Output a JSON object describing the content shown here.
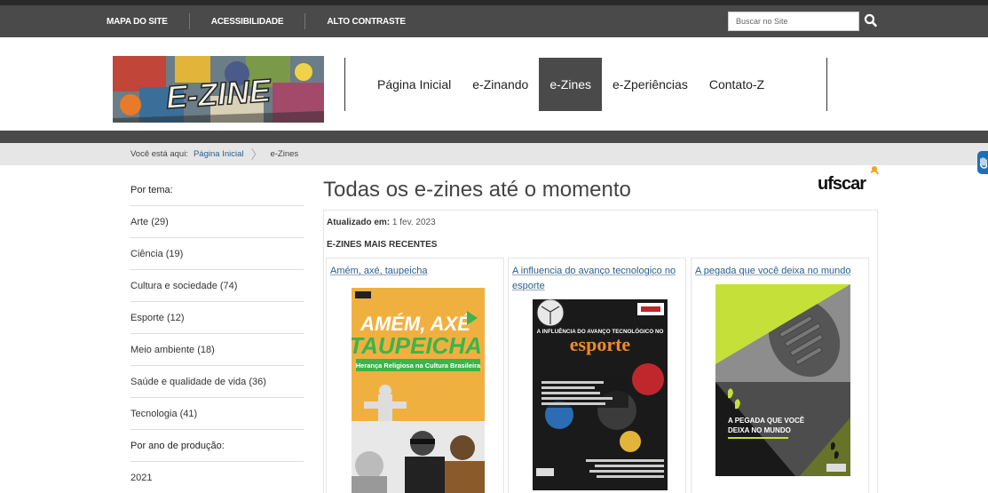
{
  "topbar": {
    "links": [
      "MAPA DO SITE",
      "ACESSIBILIDADE",
      "ALTO CONTRASTE"
    ],
    "search_placeholder": "Buscar no Site"
  },
  "logo": {
    "text": "E-ZINE"
  },
  "nav": {
    "items": [
      "Página Inicial",
      "e-Zinando",
      "e-Zines",
      "e-Zperiências",
      "Contato-Z"
    ],
    "active": "e-Zines"
  },
  "breadcrumb": {
    "prefix": "Você está aqui:",
    "items": [
      "Página Inicial",
      "e-Zines"
    ]
  },
  "sidebar": {
    "theme_heading": "Por tema:",
    "themes": [
      "Arte (29)",
      "Ciência (19)",
      "Cultura e sociedade (74)",
      "Esporte (12)",
      "Meio ambiente (18)",
      "Saúde e qualidade de vida (36)",
      "Tecnologia (41)"
    ],
    "year_heading": "Por ano de produção:",
    "years": [
      "2021"
    ]
  },
  "main": {
    "title": "Todas os e-zines até o momento",
    "updated_label": "Atualizado em:",
    "updated_value": "1 fev. 2023",
    "recent_heading": "E-ZINES MAIS RECENTES",
    "brand": "ufscar"
  },
  "cards": [
    {
      "title": "Amém, axé, taupeicha",
      "cover_title_1": "AMÉM, AXÉ",
      "cover_title_2": "TAUPEICHA",
      "cover_subtitle": "Herança Religiosa na Cultura Brasileira"
    },
    {
      "title": "A influencia do avanço tecnologico no esporte",
      "cover_title_1": "A INFLUÊNCIA DO AVANÇO TECNOLÓGICO NO",
      "cover_title_2": "esporte"
    },
    {
      "title": "A pegada que você deixa no mundo",
      "cover_title_1": "A PEGADA QUE VOCÊ",
      "cover_title_2": "DEIXA NO MUNDO"
    }
  ],
  "colors": {
    "topbar": "#4a4a4a",
    "nav_active": "#4a4a4a",
    "link": "#2a5e8a",
    "cover1_bg": "#f0b040",
    "cover1_green": "#3cb44b",
    "cover2_accent": "#f08a28",
    "cover3_lime": "#c6e03a",
    "access_blue": "#1f6fb5"
  }
}
